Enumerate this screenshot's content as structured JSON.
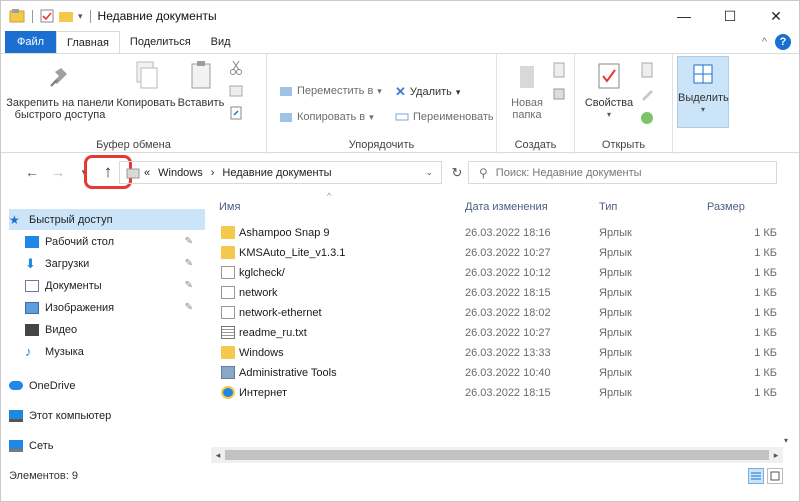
{
  "window": {
    "title": "Недавние документы",
    "controls": {
      "minimize": "—",
      "maximize": "☐",
      "close": "✕"
    }
  },
  "tabs": {
    "file": "Файл",
    "home": "Главная",
    "share": "Поделиться",
    "view": "Вид"
  },
  "ribbon": {
    "clipboard": {
      "pin_label": "Закрепить на панели быстрого доступа",
      "copy_label": "Копировать",
      "paste_label": "Вставить",
      "group_label": "Буфер обмена"
    },
    "organize": {
      "move_to": "Переместить в",
      "copy_to": "Копировать в",
      "delete": "Удалить",
      "rename": "Переименовать",
      "group_label": "Упорядочить"
    },
    "new": {
      "new_folder": "Новая папка",
      "group_label": "Создать"
    },
    "open": {
      "properties": "Свойства",
      "group_label": "Открыть"
    },
    "select": {
      "select_label": "Выделить"
    }
  },
  "address": {
    "path_prefix": "«",
    "segment1": "Windows",
    "separator": "›",
    "segment2": "Недавние документы",
    "search_placeholder": "Поиск: Недавние документы"
  },
  "nav": {
    "items": [
      {
        "label": "Быстрый доступ",
        "icon": "star-icon"
      },
      {
        "label": "Рабочий стол",
        "icon": "desktop-icon"
      },
      {
        "label": "Загрузки",
        "icon": "download-icon"
      },
      {
        "label": "Документы",
        "icon": "documents-icon"
      },
      {
        "label": "Изображения",
        "icon": "pictures-icon"
      },
      {
        "label": "Видео",
        "icon": "video-icon"
      },
      {
        "label": "Музыка",
        "icon": "music-icon"
      },
      {
        "label": "OneDrive",
        "icon": "cloud-icon"
      },
      {
        "label": "Этот компьютер",
        "icon": "computer-icon"
      },
      {
        "label": "Сеть",
        "icon": "network-icon"
      }
    ]
  },
  "table": {
    "columns": {
      "name": "Имя",
      "date": "Дата изменения",
      "type": "Тип",
      "size": "Размер"
    },
    "rows": [
      {
        "name": "Ashampoo Snap 9",
        "date": "26.03.2022 18:16",
        "type": "Ярлык",
        "size": "1 КБ",
        "icon": "folder"
      },
      {
        "name": "KMSAuto_Lite_v1.3.1",
        "date": "26.03.2022 10:27",
        "type": "Ярлык",
        "size": "1 КБ",
        "icon": "folder"
      },
      {
        "name": "kglcheck/",
        "date": "26.03.2022 10:12",
        "type": "Ярлык",
        "size": "1 КБ",
        "icon": "doc"
      },
      {
        "name": "network",
        "date": "26.03.2022 18:15",
        "type": "Ярлык",
        "size": "1 КБ",
        "icon": "doc"
      },
      {
        "name": "network-ethernet",
        "date": "26.03.2022 18:02",
        "type": "Ярлык",
        "size": "1 КБ",
        "icon": "doc"
      },
      {
        "name": "readme_ru.txt",
        "date": "26.03.2022 10:27",
        "type": "Ярлык",
        "size": "1 КБ",
        "icon": "txt"
      },
      {
        "name": "Windows",
        "date": "26.03.2022 13:33",
        "type": "Ярлык",
        "size": "1 КБ",
        "icon": "folder"
      },
      {
        "name": "Administrative Tools",
        "date": "26.03.2022 10:40",
        "type": "Ярлык",
        "size": "1 КБ",
        "icon": "admin"
      },
      {
        "name": "Интернет",
        "date": "26.03.2022 18:15",
        "type": "Ярлык",
        "size": "1 КБ",
        "icon": "ie"
      }
    ]
  },
  "status": {
    "items_count": "Элементов: 9"
  },
  "colors": {
    "accent": "#1a6fd0",
    "selection": "#cce4f7",
    "highlight": "#e53935"
  }
}
